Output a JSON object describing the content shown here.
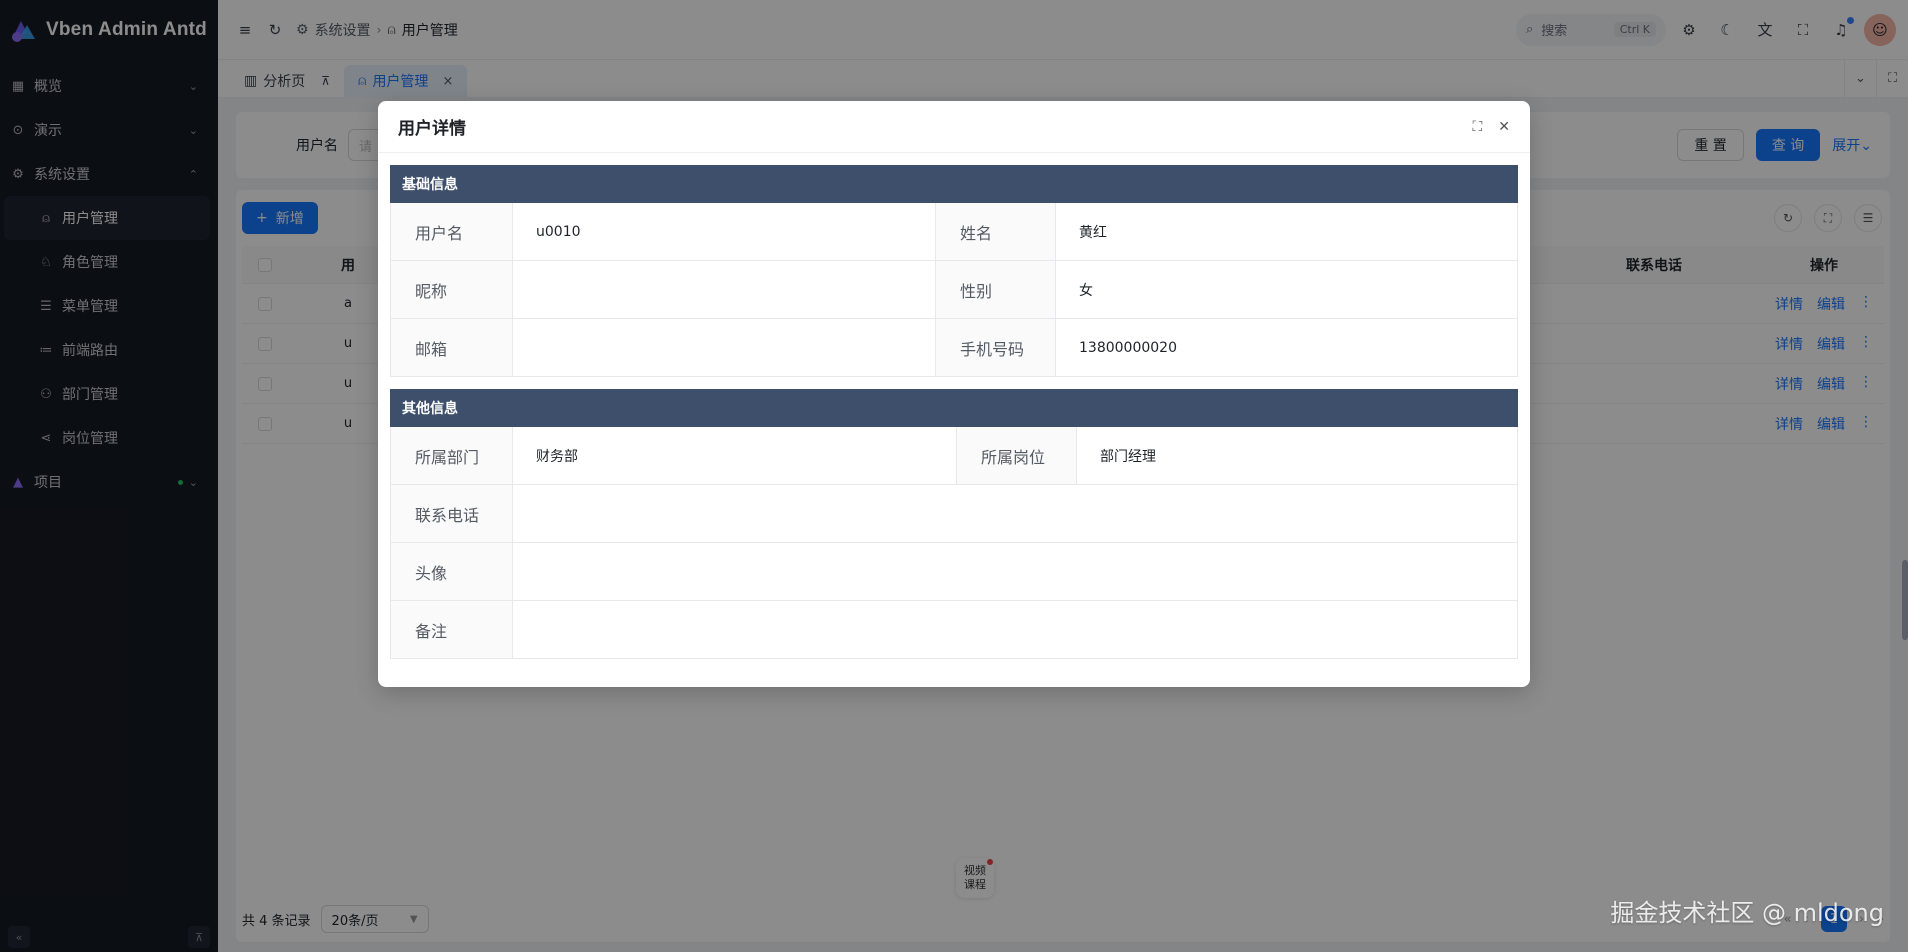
{
  "app": {
    "title": "Vben Admin Antd"
  },
  "sidebar": {
    "items": [
      {
        "label": "概览"
      },
      {
        "label": "演示"
      },
      {
        "label": "系统设置"
      },
      {
        "label": "项目"
      }
    ],
    "subitems": [
      {
        "label": "用户管理"
      },
      {
        "label": "角色管理"
      },
      {
        "label": "菜单管理"
      },
      {
        "label": "前端路由"
      },
      {
        "label": "部门管理"
      },
      {
        "label": "岗位管理"
      }
    ]
  },
  "header": {
    "breadcrumb": [
      "系统设置",
      "用户管理"
    ],
    "search_placeholder": "搜索",
    "search_shortcut": "Ctrl K"
  },
  "tabs": [
    {
      "label": "分析页"
    },
    {
      "label": "用户管理"
    }
  ],
  "search_form": {
    "username_label": "用户名",
    "username_placeholder": "请",
    "reset_label": "重 置",
    "query_label": "查 询",
    "expand_label": "展开"
  },
  "table": {
    "add_label": "新增",
    "columns": [
      "用",
      "联系电话",
      "操作"
    ],
    "rows": [
      {
        "first": "a",
        "detail": "详情",
        "edit": "编辑"
      },
      {
        "first": "u",
        "detail": "详情",
        "edit": "编辑"
      },
      {
        "first": "u",
        "detail": "详情",
        "edit": "编辑"
      },
      {
        "first": "u",
        "detail": "详情",
        "edit": "编辑"
      }
    ],
    "total_text": "共 4 条记录",
    "page_size": "20条/页",
    "current_page": "1"
  },
  "float_bubble": {
    "line1": "视频",
    "line2": "课程"
  },
  "modal": {
    "title": "用户详情",
    "basic_section": "基础信息",
    "other_section": "其他信息",
    "basic": {
      "username_label": "用户名",
      "username_value": "u0010",
      "name_label": "姓名",
      "name_value": "黄红",
      "nickname_label": "昵称",
      "nickname_value": "",
      "gender_label": "性别",
      "gender_value": "女",
      "email_label": "邮箱",
      "email_value": "",
      "phone_label": "手机号码",
      "phone_value": "13800000020"
    },
    "other": {
      "dept_label": "所属部门",
      "dept_value": "财务部",
      "post_label": "所属岗位",
      "post_value": "部门经理",
      "contact_label": "联系电话",
      "contact_value": "",
      "avatar_label": "头像",
      "avatar_value": "",
      "remark_label": "备注",
      "remark_value": ""
    }
  },
  "watermark": "掘金技术社区 @ mldong"
}
